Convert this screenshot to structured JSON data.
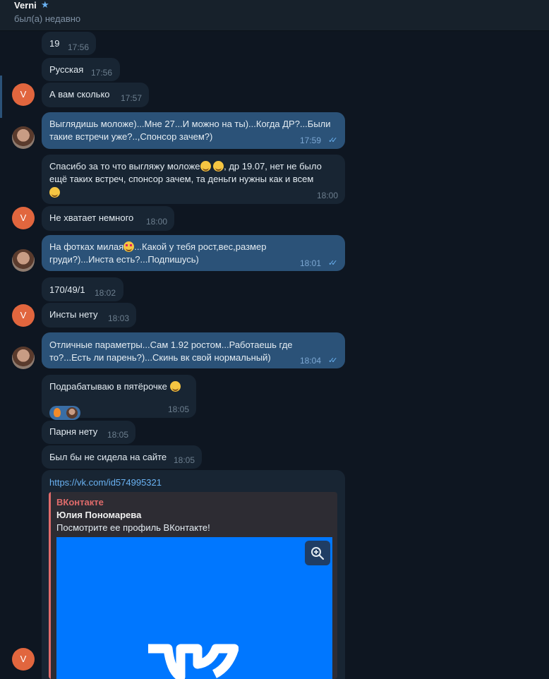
{
  "header": {
    "name": "Verni",
    "status": "был(а) недавно",
    "star_icon": "star-icon"
  },
  "messages": [
    {
      "text": "19",
      "time": "17:56"
    },
    {
      "text": "Русская",
      "time": "17:56"
    },
    {
      "text": "А вам сколько",
      "time": "17:57"
    },
    {
      "line1": "Выглядишь моложе)...Мне 27...И можно на ты)...Когда ДР?...Были",
      "line2": "такие встречи уже?..,Спонсор зачем?)",
      "time": "17:59"
    },
    {
      "line1a": "Спасибо за то что выгляжу моложе",
      "line1b": ", др 19.07, нет не было",
      "line2": "ещё таких встреч, спонсор зачем, та деньги нужны как и всем",
      "time": "18:00"
    },
    {
      "text": "Не хватает немного",
      "time": "18:00"
    },
    {
      "line1a": "На фотках милая",
      "line1b": "...Какой у тебя рост,вес,размер",
      "line2": "груди?)...Инста есть?...Подпишусь)",
      "time": "18:01"
    },
    {
      "text": "170/49/1",
      "time": "18:02"
    },
    {
      "text": "Инсты нету",
      "time": "18:03"
    },
    {
      "line1": "Отличные параметры...Сам 1.92 ростом...Работаешь где",
      "line2": "то?...Есть ли парень?)...Скинь вк свой нормальный)",
      "time": "18:04"
    },
    {
      "text": "Подрабатываю в пятёрочке",
      "time": "18:05"
    },
    {
      "text": "Парня нету",
      "time": "18:05"
    },
    {
      "text": "Был бы не сидела на сайте",
      "time": "18:05"
    }
  ],
  "link": {
    "url": "https://vk.com/id574995321",
    "site": "ВКонтакте",
    "title": "Юлия Пономарева",
    "description": "Посмотрите ее профиль ВКонтакте!"
  },
  "avatar_letter": "V",
  "colors": {
    "incoming": "#182533",
    "outgoing": "#2b5278",
    "accent": "#6ab2f2",
    "avatar": "#e1663e",
    "vk_blue": "#0077ff"
  }
}
